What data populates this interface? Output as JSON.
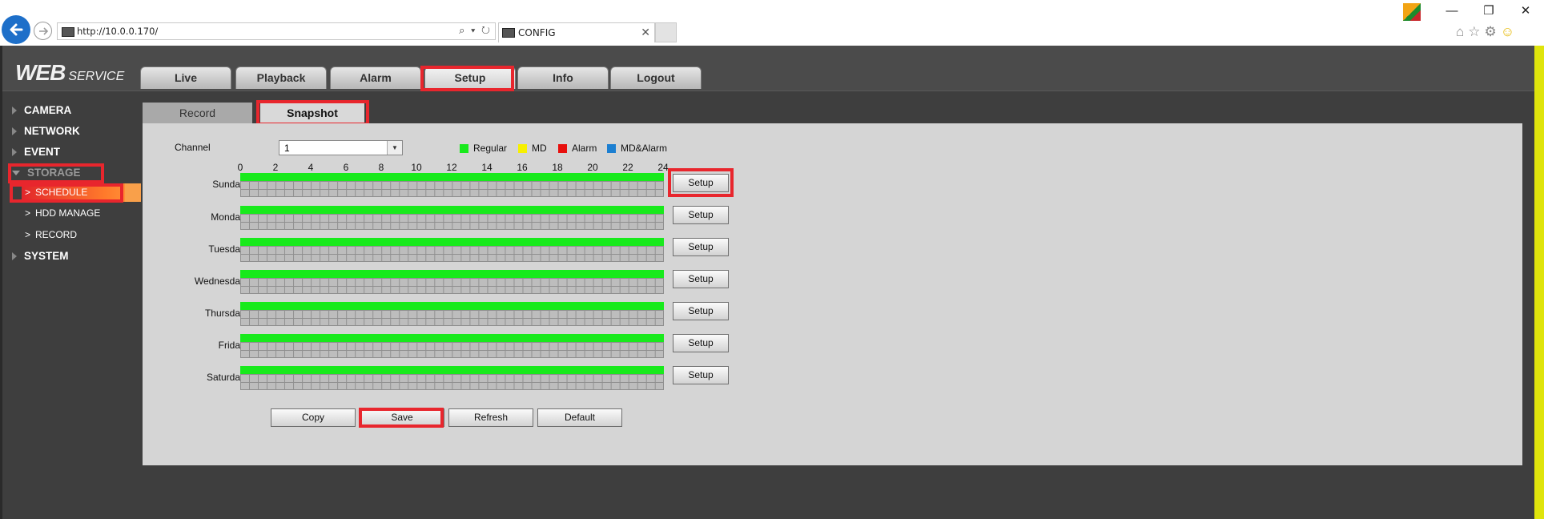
{
  "browser": {
    "url": "http://10.0.0.170/",
    "tab_title": "CONFIG",
    "window_controls": [
      "—",
      "❐",
      "✕"
    ],
    "address_tools": "⌕ ▾ ↻"
  },
  "app": {
    "logo_main": "WEB",
    "logo_sub": "SERVICE",
    "main_tabs": [
      "Live",
      "Playback",
      "Alarm",
      "Setup",
      "Info",
      "Logout"
    ],
    "active_main_tab": "Setup",
    "sidebar": {
      "items": [
        "CAMERA",
        "NETWORK",
        "EVENT",
        "STORAGE",
        "SYSTEM"
      ],
      "storage_sub": [
        "SCHEDULE",
        "HDD MANAGE",
        "RECORD"
      ]
    },
    "sub_tabs": [
      "Record",
      "Snapshot"
    ],
    "active_sub_tab": "Snapshot",
    "channel_label": "Channel",
    "channel_value": "1",
    "legend": [
      {
        "label": "Regular",
        "color": "#18ea1c"
      },
      {
        "label": "MD",
        "color": "#f7f000"
      },
      {
        "label": "Alarm",
        "color": "#e8100e"
      },
      {
        "label": "MD&Alarm",
        "color": "#1c7fd1"
      }
    ],
    "hour_ticks": [
      "0",
      "2",
      "4",
      "6",
      "8",
      "10",
      "12",
      "14",
      "16",
      "18",
      "20",
      "22",
      "24"
    ],
    "days": [
      "Sunday",
      "Monday",
      "Tuesday",
      "Wednesday",
      "Thursday",
      "Friday",
      "Saturday"
    ],
    "setup_label": "Setup",
    "buttons": {
      "copy": "Copy",
      "save": "Save",
      "refresh": "Refresh",
      "default": "Default"
    }
  },
  "colors": {
    "highlight": "#e8262d",
    "regular_bar": "#18ea1c"
  }
}
